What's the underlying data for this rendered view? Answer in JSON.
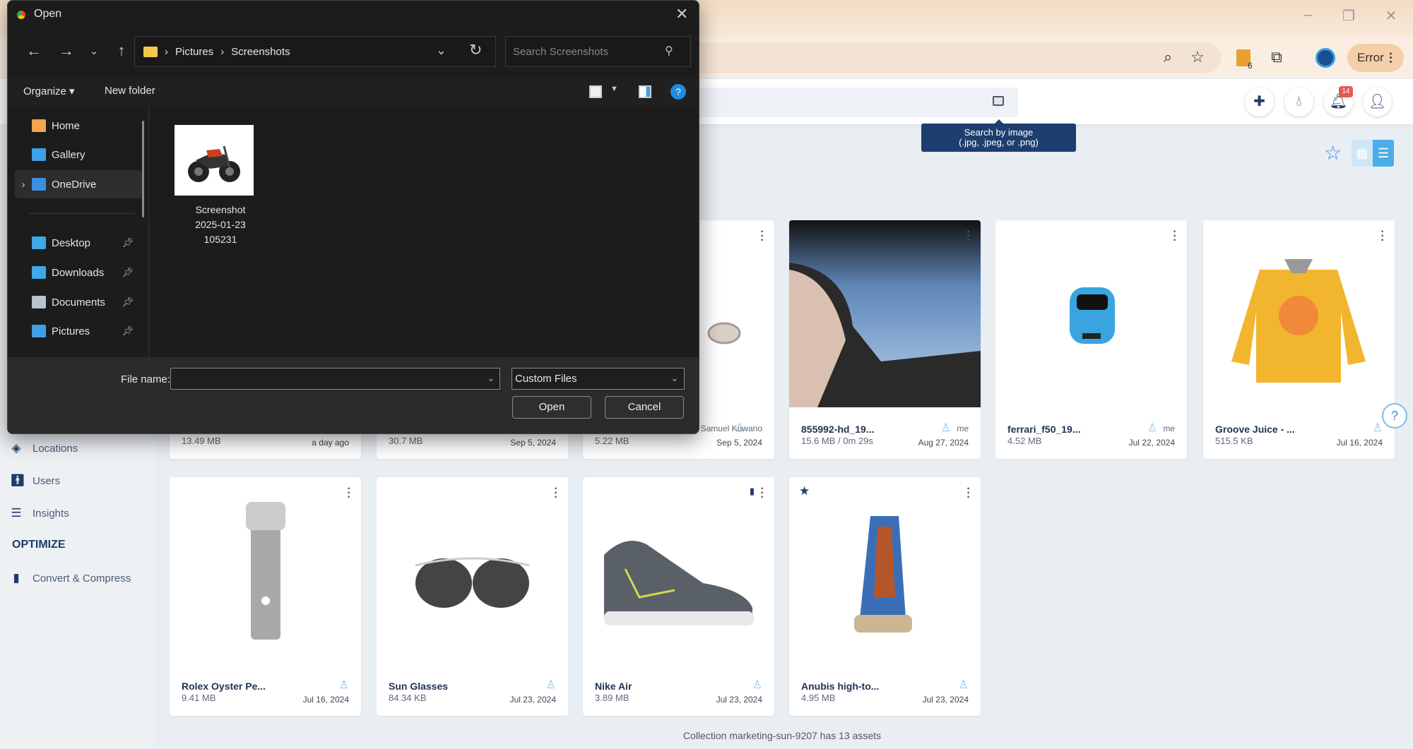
{
  "browser": {
    "error_label": "Error",
    "extension_badge": "6",
    "icons": [
      "zoom-icon",
      "bookmark-star-icon",
      "extension-icon",
      "puzzle-icon",
      "profile-icon",
      "menu-icon"
    ]
  },
  "app_header": {
    "notification_count": "14",
    "tooltip_line1": "Search by image",
    "tooltip_line2": "(.jpg, .jpeg, or .png)"
  },
  "sidebar": {
    "items": [
      {
        "label": "Locations",
        "icon": "location-icon"
      },
      {
        "label": "Users",
        "icon": "user-icon"
      },
      {
        "label": "Insights",
        "icon": "insights-icon"
      }
    ],
    "section": "OPTIMIZE",
    "optimize_items": [
      {
        "label": "Convert & Compress",
        "icon": "file-icon"
      }
    ]
  },
  "cards": [
    {
      "name": "",
      "size": "13.49 MB",
      "date": "a day ago",
      "owner": "",
      "thumb": "blank"
    },
    {
      "name": "",
      "size": "30.7 MB",
      "date": "Sep 5, 2024",
      "owner": "",
      "thumb": "blank"
    },
    {
      "name": "",
      "size": "5.22 MB",
      "date": "Sep 5, 2024",
      "owner": "Samuel Kuwano",
      "thumb": "ring"
    },
    {
      "name": "855992-hd_19...",
      "size": "15.6 MB / 0m 29s",
      "date": "Aug 27, 2024",
      "owner": "me",
      "thumb": "photo"
    },
    {
      "name": "ferrari_f50_19...",
      "size": "4.52 MB",
      "date": "Jul 22, 2024",
      "owner": "me",
      "thumb": "car"
    },
    {
      "name": "Groove Juice - ...",
      "size": "515.5 KB",
      "date": "Jul 16, 2024",
      "owner": "",
      "thumb": "hoodie"
    },
    {
      "name": "Rolex Oyster Pe...",
      "size": "9.41 MB",
      "date": "Jul 16, 2024",
      "owner": "",
      "thumb": "watch"
    },
    {
      "name": "Sun Glasses",
      "size": "84.34 KB",
      "date": "Jul 23, 2024",
      "owner": "",
      "thumb": "sunglasses"
    },
    {
      "name": "Nike Air",
      "size": "3.89 MB",
      "date": "Jul 23, 2024",
      "owner": "",
      "thumb": "sneaker",
      "comment": true
    },
    {
      "name": "Anubis high-to...",
      "size": "4.95 MB",
      "date": "Jul 23, 2024",
      "owner": "",
      "thumb": "boot",
      "starred": true
    }
  ],
  "footer": "Collection marketing-sun-9207 has 13 assets",
  "dialog": {
    "title": "Open",
    "path": [
      "Pictures",
      "Screenshots"
    ],
    "search_placeholder": "Search Screenshots",
    "organize": "Organize ▾",
    "new_folder": "New folder",
    "nav_items": [
      {
        "label": "Home",
        "color": "#f2a54a",
        "pinned": false
      },
      {
        "label": "Gallery",
        "color": "#3ea0e8",
        "pinned": false
      },
      {
        "label": "OneDrive",
        "color": "#3c8fe0",
        "pinned": false,
        "selected": true
      },
      {
        "label": "Desktop",
        "color": "#3ea8e8",
        "pinned": true
      },
      {
        "label": "Downloads",
        "color": "#3ea8e8",
        "pinned": true
      },
      {
        "label": "Documents",
        "color": "#b8c4d0",
        "pinned": true
      },
      {
        "label": "Pictures",
        "color": "#3ea0e8",
        "pinned": true
      }
    ],
    "file": {
      "line1": "Screenshot",
      "line2": "2025-01-23",
      "line3": "105231"
    },
    "file_name_label": "File name:",
    "file_name_value": "",
    "file_type": "Custom Files",
    "open_label": "Open",
    "cancel_label": "Cancel"
  }
}
